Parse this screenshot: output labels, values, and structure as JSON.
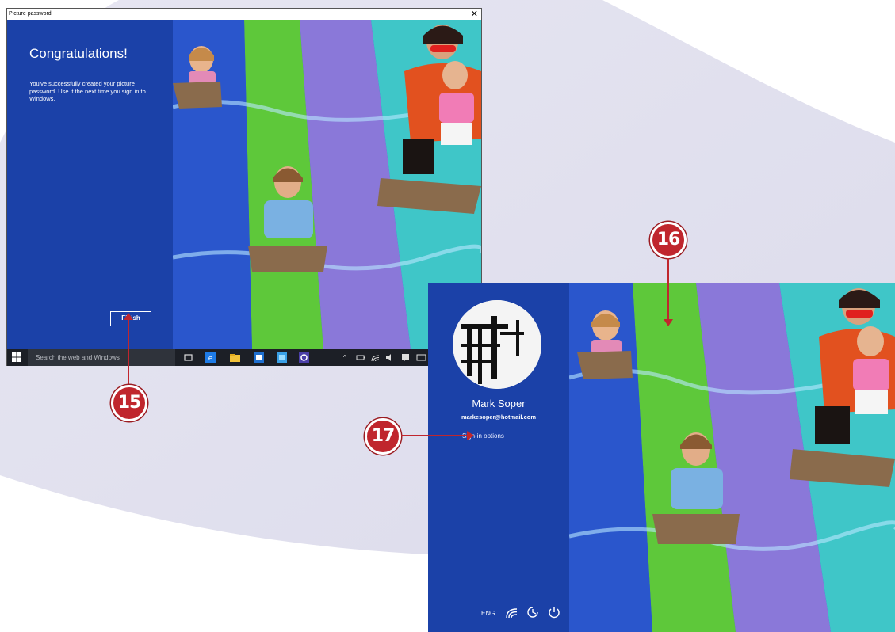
{
  "window1": {
    "title": "Picture password",
    "close_glyph": "✕",
    "heading": "Congratulations!",
    "body": "You've successfully created your picture password. Use it the next time you sign in to Windows.",
    "finish_label": "Finish",
    "photo": "slide-photo"
  },
  "taskbar": {
    "search_placeholder": "Search the web and Windows",
    "icons": [
      "start-icon",
      "task-view-icon",
      "edge-icon",
      "file-explorer-icon",
      "outlook-icon",
      "photo-viewer-icon",
      "settings-icon"
    ],
    "tray": {
      "chevron": "^",
      "icons": [
        "battery-icon",
        "wifi-icon",
        "volume-icon",
        "action-center-icon",
        "keyboard-icon"
      ]
    }
  },
  "window2": {
    "user_name": "Mark Soper",
    "user_email": "markesoper@hotmail.com",
    "signin_options_label": "Sign-in options",
    "language": "ENG",
    "bottom_icons": [
      "wifi-icon",
      "ease-of-access-icon",
      "power-icon"
    ],
    "photo": "slide-photo"
  },
  "callouts": [
    {
      "number": "15",
      "points_to": "finish-button"
    },
    {
      "number": "16",
      "points_to": "picture-password-image"
    },
    {
      "number": "17",
      "points_to": "sign-in-options-link"
    }
  ],
  "colors": {
    "panel_blue": "#1b41a8",
    "callout_red": "#c0262d",
    "taskbar": "#1c1f26",
    "slide_blue": "#2f5fd8",
    "slide_green": "#5ec83a",
    "slide_purple": "#8a78d9",
    "slide_teal": "#3fc6c8"
  }
}
